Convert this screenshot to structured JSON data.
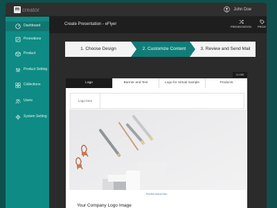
{
  "app": {
    "logo_mark": "m",
    "logo_text": "creator",
    "user_name": "John Doe"
  },
  "sidebar": {
    "items": [
      {
        "label": "Dashboard",
        "icon": "dashboard-icon",
        "active": true
      },
      {
        "label": "Promotions",
        "icon": "promotions-icon",
        "active": false
      },
      {
        "label": "Product",
        "icon": "box-icon",
        "active": false
      },
      {
        "label": "Product Setting",
        "icon": "sliders-icon",
        "active": false
      },
      {
        "label": "Collections",
        "icon": "grid-icon",
        "active": false
      },
      {
        "label": "Users",
        "icon": "users-icon",
        "active": false
      },
      {
        "label": "System Setting",
        "icon": "gear-icon",
        "active": false
      }
    ]
  },
  "header": {
    "title": "Create Presentation - eFlyer",
    "presentation_label": "PRESENTATION",
    "price_label": "PRICE"
  },
  "stepper": {
    "steps": [
      {
        "label": "1. Choose Design",
        "state": "inactive"
      },
      {
        "label": "2. Customize Content",
        "state": "active"
      },
      {
        "label": "3. Review and Send Mail",
        "state": "inactive"
      }
    ]
  },
  "editor": {
    "close_label": "CLOSE",
    "tabs": [
      {
        "label": "Logo",
        "active": true
      },
      {
        "label": "Banner and Text",
        "active": false
      },
      {
        "label": "Logo for Virtual Sample",
        "active": false
      },
      {
        "label": "Products",
        "active": false
      }
    ],
    "logo_placeholder": "Logo here",
    "preview_link": "Preview Actual Size",
    "section_title": "Your Company Logo Image"
  },
  "colors": {
    "sidebar": "#0e8b84",
    "accent_step": "#127d78",
    "background": "#0f4f4d",
    "dark": "#1a1a1a"
  }
}
